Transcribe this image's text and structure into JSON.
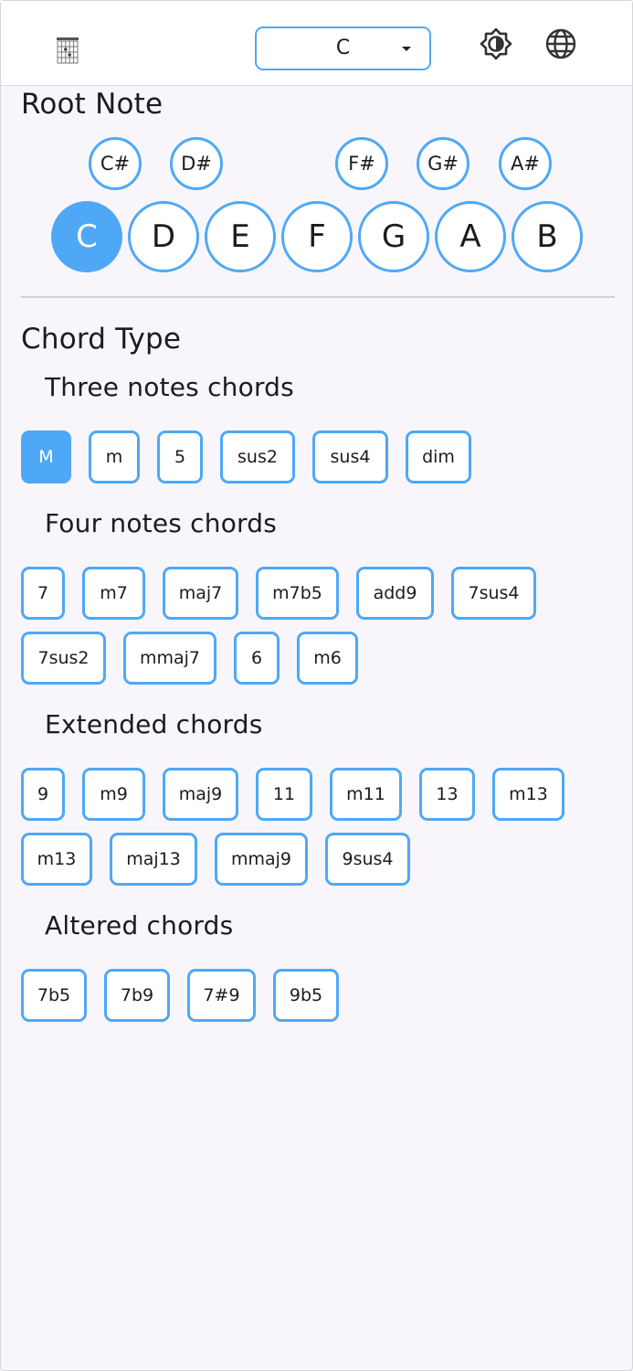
{
  "header": {
    "logo_icon": "chord-diagram-icon",
    "root_select_value": "C",
    "theme_icon": "brightness-contrast-icon",
    "language_icon": "globe-icon"
  },
  "root_note": {
    "title": "Root Note",
    "sharps": [
      "C#",
      "D#",
      "F#",
      "G#",
      "A#"
    ],
    "naturals": [
      "C",
      "D",
      "E",
      "F",
      "G",
      "A",
      "B"
    ],
    "selected": "C"
  },
  "chord_type": {
    "title": "Chord Type",
    "groups": [
      {
        "title": "Three notes chords",
        "chords": [
          "M",
          "m",
          "5",
          "sus2",
          "sus4",
          "dim"
        ]
      },
      {
        "title": "Four notes chords",
        "chords": [
          "7",
          "m7",
          "maj7",
          "m7b5",
          "add9",
          "7sus4",
          "7sus2",
          "mmaj7",
          "6",
          "m6"
        ]
      },
      {
        "title": "Extended chords",
        "chords": [
          "9",
          "m9",
          "maj9",
          "11",
          "m11",
          "13",
          "m13",
          "m13",
          "maj13",
          "mmaj9",
          "9sus4"
        ]
      },
      {
        "title": "Altered chords",
        "chords": [
          "7b5",
          "7b9",
          "7#9",
          "9b5"
        ]
      }
    ],
    "selected": "M"
  },
  "colors": {
    "accent": "#4fa8f6",
    "background": "#f8f6fb",
    "text": "#1c1b1f"
  }
}
